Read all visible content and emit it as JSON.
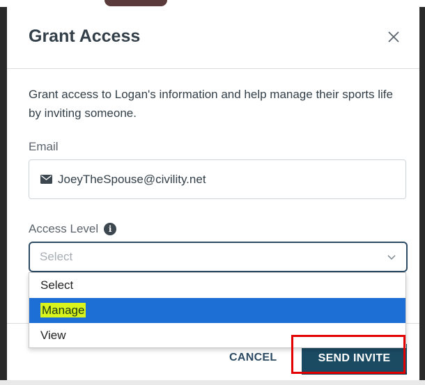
{
  "modal": {
    "title": "Grant Access",
    "intro": "Grant access to Logan's information and help manage their sports life by inviting someone."
  },
  "email": {
    "label": "Email",
    "value": "JoeyTheSpouse@civility.net"
  },
  "access_level": {
    "label": "Access Level",
    "selected_value": "Select",
    "options": [
      "Select",
      "Manage",
      "View"
    ],
    "highlighted_option": "Manage"
  },
  "footer": {
    "cancel_label": "CANCEL",
    "send_label": "SEND INVITE"
  },
  "colors": {
    "primary": "#1b4b63",
    "option_highlight": "#1d6fd6",
    "annotation": "#e30000"
  }
}
